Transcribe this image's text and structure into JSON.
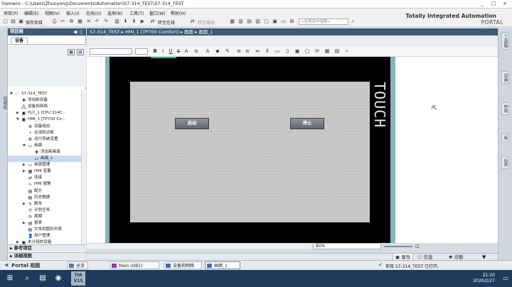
{
  "window": {
    "title": "Siemens - C:\\Users\\Zhuoyong\\Documents\\Automation\\S7-314_TEST\\S7-314_TEST",
    "controls": {
      "minimize": "_",
      "maximize": "□",
      "close": "×"
    }
  },
  "menu": [
    "项目(P)",
    "编辑(E)",
    "视图(V)",
    "插入(I)",
    "在线(O)",
    "选项(N)",
    "工具(T)",
    "窗口(W)",
    "帮助(H)"
  ],
  "toolbar": {
    "save_label": "保存项目",
    "go_online": "转至在线",
    "go_offline": "转至离线",
    "search_placeholder": "<在项目中搜索>"
  },
  "brand": {
    "line1": "Totally Integrated Automation",
    "line2": "PORTAL"
  },
  "left_strip": {
    "label": "可视化"
  },
  "project_tree": {
    "title": "项目树",
    "tab": "设备",
    "items": [
      {
        "label": "S7-314_TEST",
        "level": 0,
        "arrow": "▼",
        "icon": "📄"
      },
      {
        "label": "添加新设备",
        "level": 1,
        "arrow": "",
        "icon": "✚"
      },
      {
        "label": "设备和网络",
        "level": 1,
        "arrow": "",
        "icon": "🖧"
      },
      {
        "label": "PLC_1 [CPU 314C...",
        "level": 1,
        "arrow": "▶",
        "icon": "▣"
      },
      {
        "label": "HMI_1 [TP700 Co...",
        "level": 1,
        "arrow": "▼",
        "icon": "▣"
      },
      {
        "label": "设备组态",
        "level": 2,
        "arrow": "",
        "icon": "⚙"
      },
      {
        "label": "在线和诊断",
        "level": 2,
        "arrow": "",
        "icon": "⚡"
      },
      {
        "label": "运行系统设置",
        "level": 2,
        "arrow": "",
        "icon": "⚙"
      },
      {
        "label": "画面",
        "level": 2,
        "arrow": "▼",
        "icon": "▭"
      },
      {
        "label": "添加新画面",
        "level": 3,
        "arrow": "",
        "icon": "✚"
      },
      {
        "label": "画面_1",
        "level": 3,
        "arrow": "",
        "icon": "▭",
        "selected": true
      },
      {
        "label": "画面管理",
        "level": 2,
        "arrow": "▶",
        "icon": "▭"
      },
      {
        "label": "HMI 变量",
        "level": 2,
        "arrow": "▶",
        "icon": "▦"
      },
      {
        "label": "连接",
        "level": 2,
        "arrow": "",
        "icon": "⇄"
      },
      {
        "label": "HMI 报警",
        "level": 2,
        "arrow": "",
        "icon": "⚠"
      },
      {
        "label": "配方",
        "level": 2,
        "arrow": "",
        "icon": "▤"
      },
      {
        "label": "历史数据",
        "level": 2,
        "arrow": "",
        "icon": "▤"
      },
      {
        "label": "脚本",
        "level": 2,
        "arrow": "▶",
        "icon": "✎"
      },
      {
        "label": "计划任务",
        "level": 2,
        "arrow": "",
        "icon": "⏱"
      },
      {
        "label": "周期",
        "level": 2,
        "arrow": "",
        "icon": "⟳"
      },
      {
        "label": "报表",
        "level": 2,
        "arrow": "▶",
        "icon": "▤"
      },
      {
        "label": "文本和图形列表",
        "level": 2,
        "arrow": "",
        "icon": "▤"
      },
      {
        "label": "用户管理",
        "level": 2,
        "arrow": "",
        "icon": "👤"
      },
      {
        "label": "未分组的设备",
        "level": 1,
        "arrow": "▶",
        "icon": "▣"
      }
    ],
    "accordions": [
      "参考项目",
      "详细视图"
    ]
  },
  "breadcrumb": "S7-314_TEST ▸ HMI_1 [TP700 Comfort] ▸ 画面 ▸ 画面_1",
  "hmi": {
    "start_button": "启动",
    "stop_button": "停止",
    "brand": "TOUCH"
  },
  "zoom": "80%",
  "inspector_tabs": {
    "properties": "属性",
    "info": "信息",
    "diagnostics": "诊断"
  },
  "right_tabs": [
    "工具箱",
    "动画",
    "布局",
    "库",
    "任务"
  ],
  "portal_view": {
    "label": "Portal 视图",
    "overview": "总览",
    "tasks": [
      {
        "label": "Main (OB1)",
        "color": "#8a3ea8"
      },
      {
        "label": "设备和网络",
        "color": "#3f6fb0"
      },
      {
        "label": "画面_1",
        "color": "#3f6fb0",
        "active": true
      }
    ],
    "status": "项目 S7-314_TEST 已打开。"
  },
  "taskbar": {
    "tia_label": "TIA V15",
    "time": "21:20",
    "date": "2020/2/27"
  }
}
